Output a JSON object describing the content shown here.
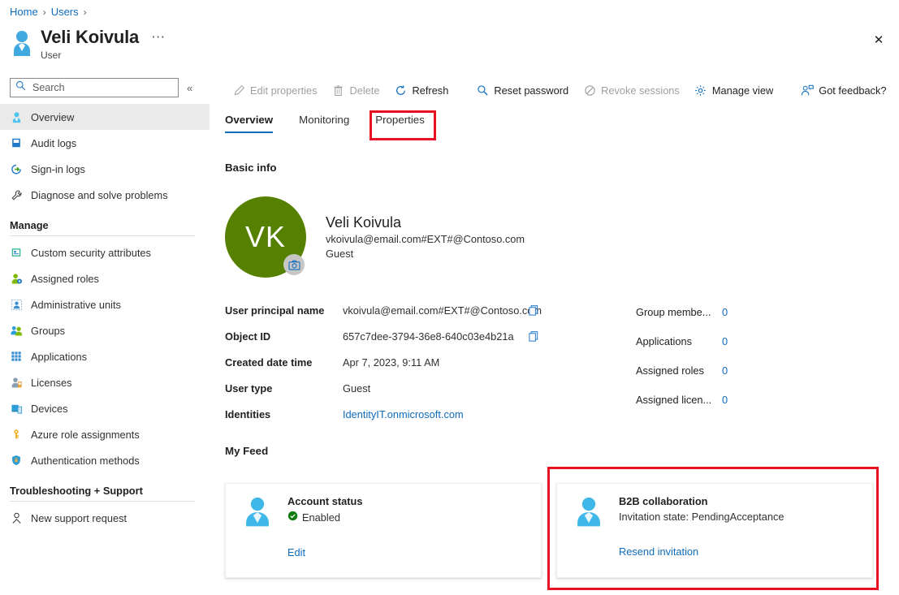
{
  "breadcrumb": {
    "items": [
      "Home",
      "Users"
    ],
    "separator": "›"
  },
  "header": {
    "title": "Veli Koivula",
    "subtitle": "User",
    "more_label": "⋯",
    "close_label": "✕",
    "avatar_icon": "user-icon"
  },
  "search": {
    "placeholder": "Search",
    "value": "",
    "icon": "search-icon"
  },
  "collapse": {
    "label": "«"
  },
  "sidebar": {
    "items": [
      {
        "label": "Overview",
        "icon": "user-icon",
        "active": true
      },
      {
        "label": "Audit logs",
        "icon": "book-icon",
        "active": false
      },
      {
        "label": "Sign-in logs",
        "icon": "signin-arrow-icon",
        "active": false
      },
      {
        "label": "Diagnose and solve problems",
        "icon": "wrench-icon",
        "active": false
      }
    ],
    "group_manage": {
      "title": "Manage",
      "items": [
        {
          "label": "Custom security attributes",
          "icon": "security-attribute-icon"
        },
        {
          "label": "Assigned roles",
          "icon": "assigned-roles-icon"
        },
        {
          "label": "Administrative units",
          "icon": "administrative-units-icon"
        },
        {
          "label": "Groups",
          "icon": "groups-icon"
        },
        {
          "label": "Applications",
          "icon": "applications-grid-icon"
        },
        {
          "label": "Licenses",
          "icon": "licenses-icon"
        },
        {
          "label": "Devices",
          "icon": "devices-icon"
        },
        {
          "label": "Azure role assignments",
          "icon": "key-icon"
        },
        {
          "label": "Authentication methods",
          "icon": "shield-lock-icon"
        }
      ]
    },
    "group_troubleshooting": {
      "title": "Troubleshooting + Support",
      "items": [
        {
          "label": "New support request",
          "icon": "support-person-icon"
        }
      ]
    }
  },
  "toolbar": {
    "buttons": [
      {
        "label": "Edit properties",
        "icon": "pencil-icon",
        "disabled": true
      },
      {
        "label": "Delete",
        "icon": "trash-icon",
        "disabled": true
      },
      {
        "label": "Refresh",
        "icon": "refresh-icon",
        "disabled": false
      },
      {
        "label": "Reset password",
        "icon": "key-search-icon",
        "disabled": false
      },
      {
        "label": "Revoke sessions",
        "icon": "block-icon",
        "disabled": true
      },
      {
        "label": "Manage view",
        "icon": "gear-icon",
        "disabled": false
      },
      {
        "label": "Got feedback?",
        "icon": "feedback-person-icon",
        "disabled": false
      }
    ]
  },
  "tabs": [
    {
      "label": "Overview",
      "selected": true,
      "highlighted": false
    },
    {
      "label": "Monitoring",
      "selected": false,
      "highlighted": false
    },
    {
      "label": "Properties",
      "selected": false,
      "highlighted": true
    }
  ],
  "main": {
    "basic_info_heading": "Basic info",
    "my_feed_heading": "My Feed",
    "profile": {
      "initials": "VK",
      "avatar_color": "#558000",
      "name": "Veli Koivula",
      "upn": "vkoivula@email.com#EXT#@Contoso.com",
      "user_type": "Guest",
      "camera_icon": "camera-icon"
    },
    "details_left": [
      {
        "label": "User principal name",
        "value": "vkoivula@email.com#EXT#@Contoso.com",
        "copy": true,
        "link": false
      },
      {
        "label": "Object ID",
        "value": "657c7dee-3794-36e8-640c03e4b21a",
        "copy": true,
        "link": false
      },
      {
        "label": "Created date time",
        "value": "Apr 7, 2023, 9:11 AM",
        "copy": false,
        "link": false
      },
      {
        "label": "User type",
        "value": "Guest",
        "copy": false,
        "link": false
      },
      {
        "label": "Identities",
        "value": "IdentityIT.onmicrosoft.com",
        "copy": false,
        "link": true
      }
    ],
    "details_right": [
      {
        "label": "Group membe...",
        "value": "0"
      },
      {
        "label": "Applications",
        "value": "0"
      },
      {
        "label": "Assigned roles",
        "value": "0"
      },
      {
        "label": "Assigned licen...",
        "value": "0"
      }
    ],
    "feed_cards": [
      {
        "title": "Account status",
        "subtitle": "Enabled",
        "status_icon": "check-circle-icon",
        "status_color": "#107c10",
        "link": "Edit",
        "icon": "user-icon",
        "highlighted": false
      },
      {
        "title": "B2B collaboration",
        "subtitle": "Invitation state: PendingAcceptance",
        "status_icon": "",
        "status_color": "",
        "link": "Resend invitation",
        "icon": "user-icon",
        "highlighted": true
      }
    ]
  },
  "colors": {
    "accent": "#0f6cbd",
    "highlight_red": "#e81123",
    "avatar_green": "#558000",
    "success_green": "#107c10"
  }
}
